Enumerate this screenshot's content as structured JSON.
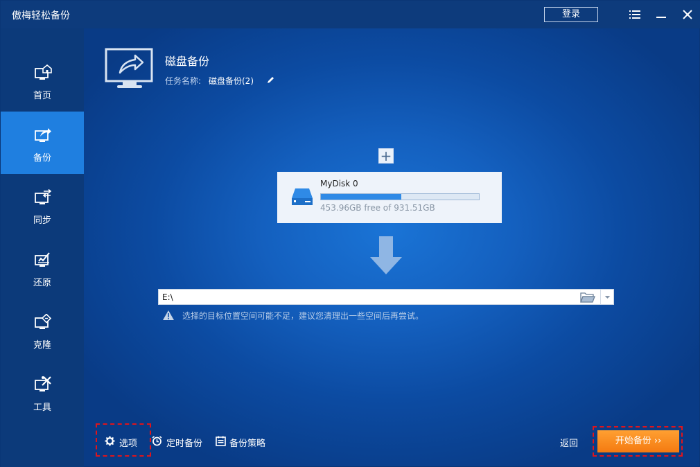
{
  "app": {
    "title": "傲梅轻松备份",
    "login_label": "登录"
  },
  "colors": {
    "accent": "#1f7fe0",
    "start_button": "#f47a10",
    "highlight_box": "#e0141b"
  },
  "sidebar": {
    "items": [
      {
        "label": "首页",
        "icon": "home-monitor-icon"
      },
      {
        "label": "备份",
        "icon": "backup-monitor-icon",
        "active": true
      },
      {
        "label": "同步",
        "icon": "sync-monitor-icon"
      },
      {
        "label": "还原",
        "icon": "restore-monitor-icon"
      },
      {
        "label": "克隆",
        "icon": "clone-monitor-icon"
      },
      {
        "label": "工具",
        "icon": "tools-monitor-icon"
      }
    ]
  },
  "header": {
    "title": "磁盘备份",
    "task_label": "任务名称:",
    "task_name": "磁盘备份(2)"
  },
  "source": {
    "add_label": "+",
    "disk_name": "MyDisk 0",
    "usage_fraction": 0.51,
    "free_text": "453.96GB free of 931.51GB"
  },
  "destination": {
    "value": "E:\\",
    "warning": "选择的目标位置空间可能不足，建议您清理出一些空间后再尝试。"
  },
  "footer": {
    "options_label": "选项",
    "schedule_label": "定时备份",
    "policy_label": "备份策略",
    "back_label": "返回",
    "start_label": "开始备份 ››"
  }
}
